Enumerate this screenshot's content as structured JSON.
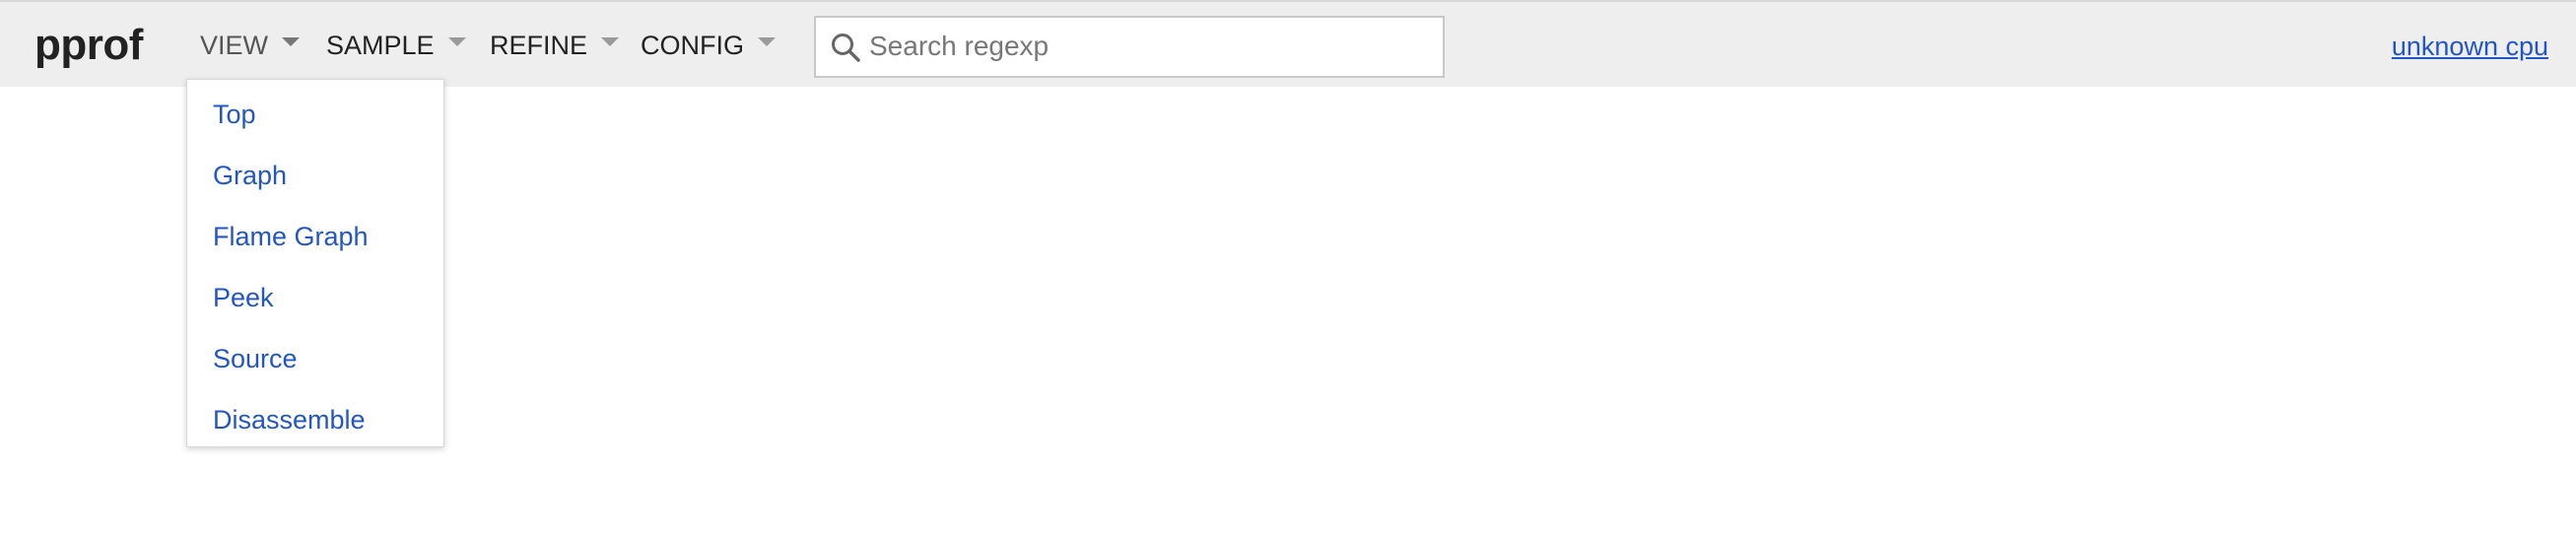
{
  "app": {
    "logo": "pprof"
  },
  "menus": [
    {
      "label": "VIEW",
      "state": "open"
    },
    {
      "label": "SAMPLE"
    },
    {
      "label": "REFINE"
    },
    {
      "label": "CONFIG"
    }
  ],
  "search": {
    "placeholder": "Search regexp",
    "value": "",
    "icon": "search-icon"
  },
  "profile_link": "unknown cpu",
  "view_dropdown": {
    "items": [
      {
        "label": "Top"
      },
      {
        "label": "Graph"
      },
      {
        "label": "Flame Graph"
      },
      {
        "label": "Peek"
      },
      {
        "label": "Source"
      },
      {
        "label": "Disassemble"
      }
    ]
  },
  "colors": {
    "header_bg": "#eeeeee",
    "link": "#2256c8",
    "text": "#222222"
  }
}
